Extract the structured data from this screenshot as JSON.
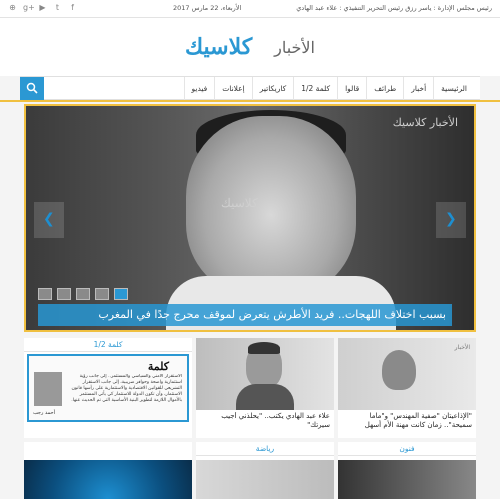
{
  "topbar": {
    "credits": "رئيس مجلس الإدارة : ياسر رزق  رئيس التحرير التنفيذي : علاء عبد الهادي",
    "date": "الأربعاء، 22 مارس 2017",
    "social": [
      "rss-icon",
      "google-plus-icon",
      "youtube-icon",
      "twitter-icon",
      "facebook-icon"
    ]
  },
  "header": {
    "logo_word1": "الأخبار",
    "logo_word2": "كلاسيك"
  },
  "nav": {
    "items": [
      "الرئيسية",
      "أخبار",
      "طرائف",
      "قالوا",
      "1/2 كلمة",
      "كاريكاتير",
      "إعلانات",
      "فيديو"
    ],
    "search_icon": "search-icon"
  },
  "slider": {
    "caption": "بسبب اختلاف اللهجات.. فريد الأطرش يتعرض لموقف محرج جدًا في المغرب",
    "watermark": "كلاسيك",
    "watermark2": "الأخبار كلاسيك",
    "prev_icon": "chevron-left-icon",
    "next_icon": "chevron-right-icon",
    "thumb_count": 5,
    "active_thumb": 4
  },
  "cards": {
    "card1_title": "\"الإذاعيتان \"صفية المهندس\" و\"ماما سميحة\".. زمان كانت مهنة الأم أسهل",
    "card2_title": "علاء عبد الهادي يكتب.. \"يحلذني أجيب سيرتك\"",
    "kalema_head": "كلمة 1/2",
    "kalema_title": "كلمة",
    "kalema_text": "الاستقرار الأمني والسياسي والمستثمر.. إلى جانب رؤية استثمارية واضحة وحوافز ضريبية، إلى جانب الاستقرار التشريعي للقوانين الاقتصادية والاستثمارية على رأسها قانون الاستثمار، وأن تكون الدولة للاستثمار كي يأتي المستثمر بالأموال اللازمة لتطوير البنية الأساسية التي تم الحديث عنها.",
    "kalema_sign": "أحمد رجب",
    "sports_head": "رياضة",
    "arts_head": "فنون"
  }
}
